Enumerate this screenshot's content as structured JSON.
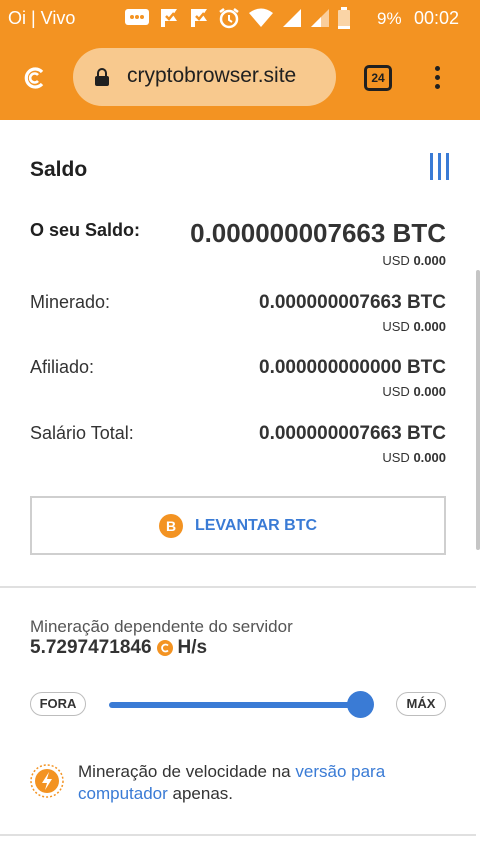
{
  "status_bar": {
    "carrier": "Oi | Vivo",
    "battery": "9%",
    "time": "00:02"
  },
  "browser": {
    "url": "cryptobrowser.site",
    "tab_count": "24"
  },
  "colors": {
    "brand_orange": "#f39322",
    "accent_blue": "#3a7bd5"
  },
  "balance": {
    "title": "Saldo",
    "rows": [
      {
        "label": "O seu Saldo:",
        "btc": "0.000000007663 BTC",
        "usd_prefix": "USD",
        "usd": "0.000"
      },
      {
        "label": "Minerado:",
        "btc": "0.000000007663 BTC",
        "usd_prefix": "USD",
        "usd": "0.000"
      },
      {
        "label": "Afiliado:",
        "btc": "0.000000000000 BTC",
        "usd_prefix": "USD",
        "usd": "0.000"
      },
      {
        "label": "Salário Total:",
        "btc": "0.000000007663 BTC",
        "usd_prefix": "USD",
        "usd": "0.000"
      }
    ],
    "withdraw_label": "LEVANTAR BTC",
    "withdraw_icon_letter": "B"
  },
  "mining": {
    "label": "Mineração dependente do servidor",
    "rate": "5.7297471846",
    "unit": "H/s",
    "min_label": "FORA",
    "max_label": "MÁX",
    "slider_level": 1.0
  },
  "note": {
    "text_before": "Mineração de velocidade na ",
    "link": "versão para computador",
    "text_after": " apenas."
  }
}
